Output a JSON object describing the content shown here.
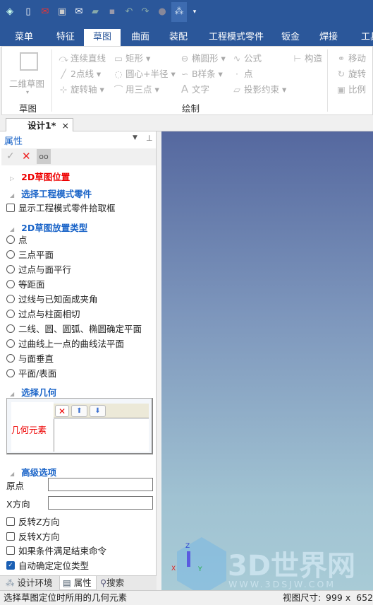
{
  "quick_access": [
    "app-logo-icon",
    "new-icon",
    "open-red-icon",
    "preview-icon",
    "mail-icon",
    "folder-icon",
    "save-icon",
    "undo-icon",
    "redo-icon",
    "globe-icon",
    "tree-icon",
    "dropdown-icon"
  ],
  "menu_tabs": [
    "菜单",
    "特征",
    "草图",
    "曲面",
    "装配",
    "工程模式零件",
    "钣金",
    "焊接",
    "工具"
  ],
  "active_tab": "草图",
  "ribbon": {
    "sketch_group": {
      "button": "二维草图",
      "label": "草图"
    },
    "draw_group": {
      "label": "绘制",
      "items": [
        "连续直线",
        "矩形",
        "椭圆形",
        "公式",
        "构造",
        "2点线",
        "圆心+半径",
        "B样条",
        "点",
        "旋转轴",
        "用三点",
        "文字",
        "投影约束"
      ]
    },
    "edit_items": [
      "移动",
      "旋转",
      "比例"
    ]
  },
  "document_tab": {
    "label": "设计1*",
    "close": "×"
  },
  "panel": {
    "title": "属性",
    "sections": {
      "position": "2D草图位置",
      "select_part": "选择工程模式零件",
      "placement_type": "2D草图放置类型",
      "select_geometry": "选择几何",
      "advanced": "高级选项"
    },
    "show_picker_checkbox": "显示工程模式零件拾取框",
    "placement_options": [
      "点",
      "三点平面",
      "过点与面平行",
      "等距面",
      "过线与已知面成夹角",
      "过点与柱面相切",
      "二线、圆、圆弧、椭圆确定平面",
      "过曲线上一点的曲线法平面",
      "与面垂直",
      "平面/表面"
    ],
    "geometry_label": "几何元素",
    "origin_label": "原点",
    "origin_value": "",
    "xdir_label": "X方向",
    "xdir_value": "",
    "checkboxes": [
      {
        "label": "反转Z方向",
        "checked": false
      },
      {
        "label": "反转X方向",
        "checked": false
      },
      {
        "label": "如果条件满足结束命令",
        "checked": false
      },
      {
        "label": "自动确定定位类型",
        "checked": true
      }
    ],
    "bottom_tabs": [
      "设计环境",
      "属性",
      "搜索"
    ]
  },
  "watermark": {
    "text": "3D世界网",
    "url": "WWW.3DSJW.COM"
  },
  "axes": {
    "x": "X",
    "y": "Y",
    "z": "Z"
  },
  "status": {
    "message": "选择草图定位时所用的几何元素",
    "view_size_label": "视图尺寸:",
    "view_size": "999 x  652"
  }
}
